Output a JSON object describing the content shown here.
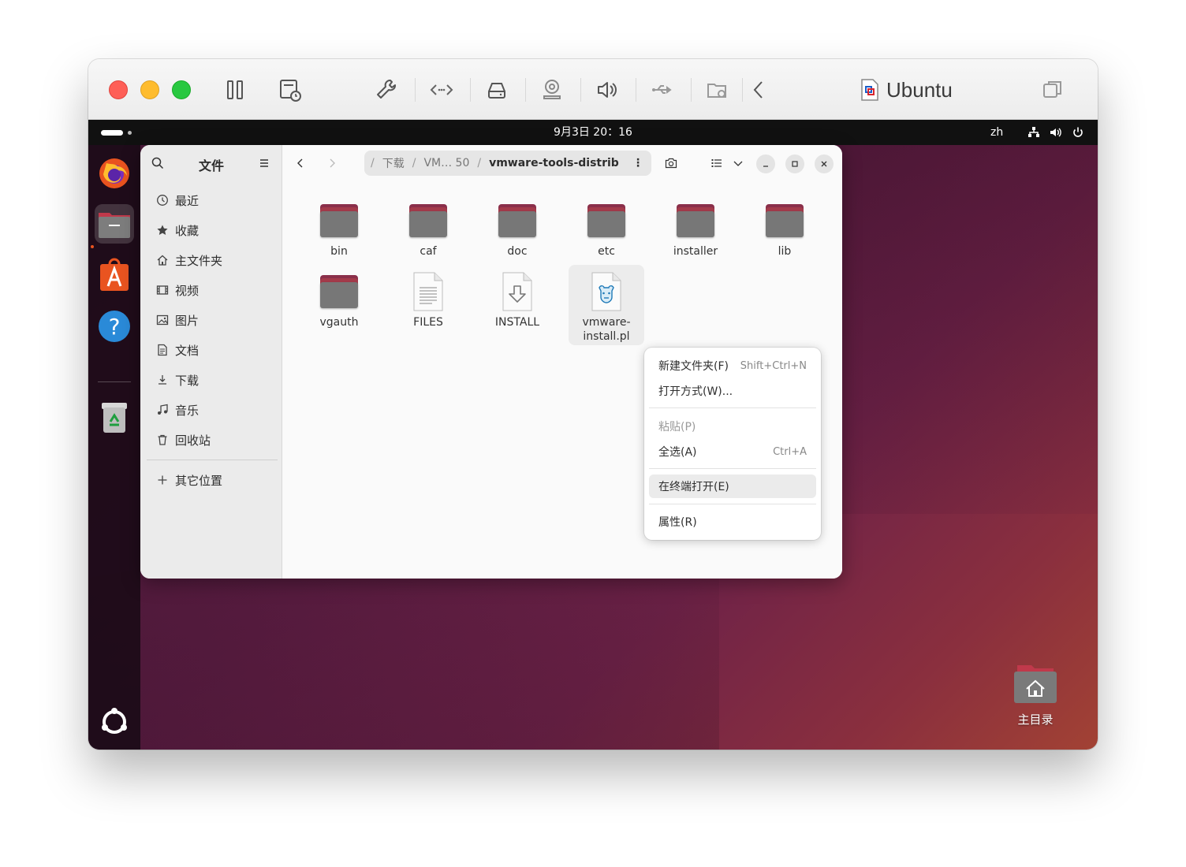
{
  "vm": {
    "title": "Ubuntu",
    "icons": [
      "pause-icon",
      "snapshot-icon",
      "wrench-icon",
      "code-icon",
      "drive-icon",
      "camera-icon",
      "speaker-icon",
      "usb-icon",
      "shared-folder-icon",
      "chevron-left-icon",
      "window-icon"
    ]
  },
  "topbar": {
    "clock": "9月3日 20：16",
    "language": "zh"
  },
  "files": {
    "sidebar_title": "文件",
    "sidebar": [
      {
        "label": "最近",
        "icon": "clock-icon"
      },
      {
        "label": "收藏",
        "icon": "star-icon"
      },
      {
        "label": "主文件夹",
        "icon": "home-icon"
      },
      {
        "label": "视频",
        "icon": "film-icon"
      },
      {
        "label": "图片",
        "icon": "image-icon"
      },
      {
        "label": "文档",
        "icon": "document-icon"
      },
      {
        "label": "下载",
        "icon": "download-icon"
      },
      {
        "label": "音乐",
        "icon": "music-icon"
      },
      {
        "label": "回收站",
        "icon": "trash-icon"
      }
    ],
    "other_locations": "其它位置",
    "path": {
      "seg1": "下载",
      "seg2": "VM… 50",
      "current": "vmware-tools-distrib",
      "more": "⋮"
    },
    "items": [
      {
        "label": "bin",
        "type": "folder"
      },
      {
        "label": "caf",
        "type": "folder"
      },
      {
        "label": "doc",
        "type": "folder"
      },
      {
        "label": "etc",
        "type": "folder"
      },
      {
        "label": "installer",
        "type": "folder"
      },
      {
        "label": "lib",
        "type": "folder"
      },
      {
        "label": "vgauth",
        "type": "folder"
      },
      {
        "label": "FILES",
        "type": "text"
      },
      {
        "label": "INSTALL",
        "type": "install"
      },
      {
        "label": "vmware-\ninstall.pl",
        "type": "script"
      }
    ]
  },
  "context_menu": {
    "new_folder": "新建文件夹(F)",
    "new_folder_shortcut": "Shift+Ctrl+N",
    "open_with": "打开方式(W)...",
    "paste": "粘贴(P)",
    "select_all": "全选(A)",
    "select_all_shortcut": "Ctrl+A",
    "open_terminal": "在终端打开(E)",
    "properties": "属性(R)"
  },
  "desktop": {
    "home_label": "主目录"
  },
  "colors": {
    "accent": "#e95420",
    "folder_tab": "#a33a4a",
    "folder_body": "#777777"
  }
}
